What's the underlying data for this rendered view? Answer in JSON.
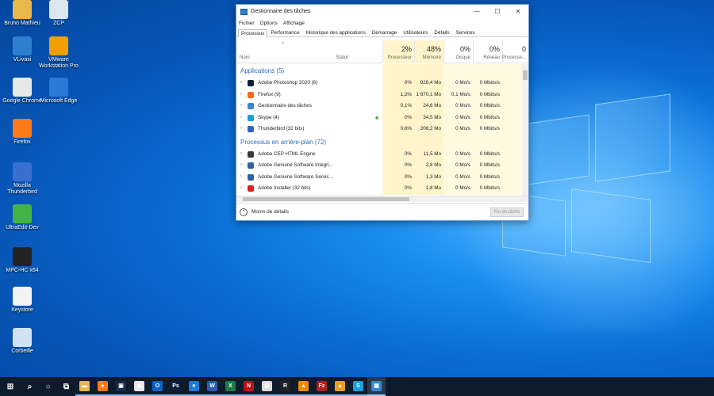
{
  "desktop": {
    "icons": [
      {
        "label": "Bruno Mathieu",
        "icon": "user-folder-icon",
        "color": "#e8b84a"
      },
      {
        "label": "ZCP",
        "icon": "recycle-folder-icon",
        "color": "#dbe6ee"
      },
      {
        "label": "VLivasi",
        "icon": "globe-icon",
        "color": "#2f7fd0"
      },
      {
        "label": "VMware Workstation Pro",
        "icon": "vmware-icon",
        "color": "#f0a000"
      },
      {
        "label": "Google Chrome",
        "icon": "chrome-icon",
        "color": "#e8e8e8"
      },
      {
        "label": "Microsoft Edge",
        "icon": "edge-icon",
        "color": "#2a7ad6"
      },
      {
        "label": "Firefox",
        "icon": "firefox-icon",
        "color": "#ff7a18"
      },
      {
        "label": "Mozilla Thunderbird",
        "icon": "thunderbird-icon",
        "color": "#3a6fd0"
      },
      {
        "label": "UltraEdit-Dev",
        "icon": "ultraedit-icon",
        "color": "#43b343"
      },
      {
        "label": "MPC-HC x64",
        "icon": "mpc-icon",
        "color": "#222222"
      },
      {
        "label": "Keystore",
        "icon": "java-icon",
        "color": "#f4f4f4"
      },
      {
        "label": "Corbeille",
        "icon": "recycle-bin-icon",
        "color": "#cfe3f0"
      }
    ]
  },
  "window": {
    "title": "Gestionnaire des tâches",
    "menu": [
      "Fichier",
      "Options",
      "Affichage"
    ],
    "tabs": [
      "Processus",
      "Performance",
      "Historique des applications",
      "Démarrage",
      "Utilisateurs",
      "Détails",
      "Services"
    ],
    "columns": {
      "nom": "Nom",
      "statut": "Statut",
      "cpu_pct": "2%",
      "cpu": "Processeur",
      "mem_pct": "48%",
      "mem": "Mémoire",
      "disk_pct": "0%",
      "disk": "Disque",
      "net_pct": "0%",
      "net": "Réseau",
      "gpu_pct": "0",
      "gpu": "Processe..."
    },
    "groups": {
      "apps": "Applications (5)",
      "background": "Processus en arrière-plan (72)"
    },
    "apps": [
      {
        "name": "Adobe Photoshop 2020 (6)",
        "icon": "photoshop-icon",
        "color": "#0a1e3c",
        "cpu": "0%",
        "mem": "928,4 Mo",
        "disk": "0 Mo/s",
        "net": "0 Mbits/s"
      },
      {
        "name": "Firefox (9)",
        "icon": "firefox-icon",
        "color": "#ff6a1a",
        "cpu": "1,2%",
        "mem": "1 670,1 Mo",
        "disk": "0,1 Mo/s",
        "net": "0 Mbits/s"
      },
      {
        "name": "Gestionnaire des tâches",
        "icon": "task-manager-icon",
        "color": "#3b86d6",
        "cpu": "0,1%",
        "mem": "24,6 Mo",
        "disk": "0 Mo/s",
        "net": "0 Mbits/s"
      },
      {
        "name": "Skype (4)",
        "icon": "skype-icon",
        "color": "#16a0e0",
        "cpu": "0%",
        "mem": "34,5 Mo",
        "disk": "0 Mo/s",
        "net": "0 Mbits/s"
      },
      {
        "name": "Thunderbird (32 bits)",
        "icon": "thunderbird-icon",
        "color": "#2f64c8",
        "cpu": "0,6%",
        "mem": "206,2 Mo",
        "disk": "0 Mo/s",
        "net": "0 Mbits/s"
      }
    ],
    "background": [
      {
        "name": "Adobe CEP HTML Engine",
        "icon": "adobe-cep-icon",
        "color": "#3a3a3a",
        "cpu": "0%",
        "mem": "11,5 Mo",
        "disk": "0 Mo/s",
        "net": "0 Mbits/s"
      },
      {
        "name": "Adobe Genuine Software Integri...",
        "icon": "adobe-genuine-icon",
        "color": "#2e5fa8",
        "cpu": "0%",
        "mem": "2,8 Mo",
        "disk": "0 Mo/s",
        "net": "0 Mbits/s"
      },
      {
        "name": "Adobe Genuine Software Servic...",
        "icon": "adobe-genuine-icon",
        "color": "#2e5fa8",
        "cpu": "0%",
        "mem": "1,3 Mo",
        "disk": "0 Mo/s",
        "net": "0 Mbits/s"
      },
      {
        "name": "Adobe Installer (32 bits)",
        "icon": "adobe-installer-icon",
        "color": "#e02020",
        "cpu": "0%",
        "mem": "1,8 Mo",
        "disk": "0 Mo/s",
        "net": "0 Mbits/s"
      }
    ],
    "footer": {
      "less_details": "Moins de détails",
      "end_task": "Fin de tâche"
    }
  },
  "taskbar": {
    "items": [
      {
        "icon": "start-windows-icon",
        "glyph": "⊞"
      },
      {
        "icon": "search-icon",
        "glyph": "⌕"
      },
      {
        "icon": "cortana-icon",
        "glyph": "○"
      },
      {
        "icon": "task-view-icon",
        "glyph": "⧉"
      },
      {
        "icon": "file-explorer-icon",
        "glyph": "▬"
      },
      {
        "icon": "firefox-icon",
        "glyph": "●"
      },
      {
        "icon": "ps-icon",
        "glyph": "▣"
      },
      {
        "icon": "chrome-icon",
        "glyph": "◉"
      },
      {
        "icon": "outlook-icon",
        "glyph": "O"
      },
      {
        "icon": "photoshop-icon",
        "glyph": "Ps"
      },
      {
        "icon": "edge-icon",
        "glyph": "e"
      },
      {
        "icon": "word-icon",
        "glyph": "W"
      },
      {
        "icon": "excel-icon",
        "glyph": "X"
      },
      {
        "icon": "netflix-icon",
        "glyph": "N"
      },
      {
        "icon": "chart-app-icon",
        "glyph": "▤"
      },
      {
        "icon": "rom-app-icon",
        "glyph": "R"
      },
      {
        "icon": "vlc-like-icon",
        "glyph": "▲"
      },
      {
        "icon": "filezilla-icon",
        "glyph": "Fz"
      },
      {
        "icon": "triangle-app-icon",
        "glyph": "▲"
      },
      {
        "icon": "skype-icon",
        "glyph": "S"
      },
      {
        "icon": "task-manager-icon",
        "glyph": "▦"
      }
    ]
  }
}
